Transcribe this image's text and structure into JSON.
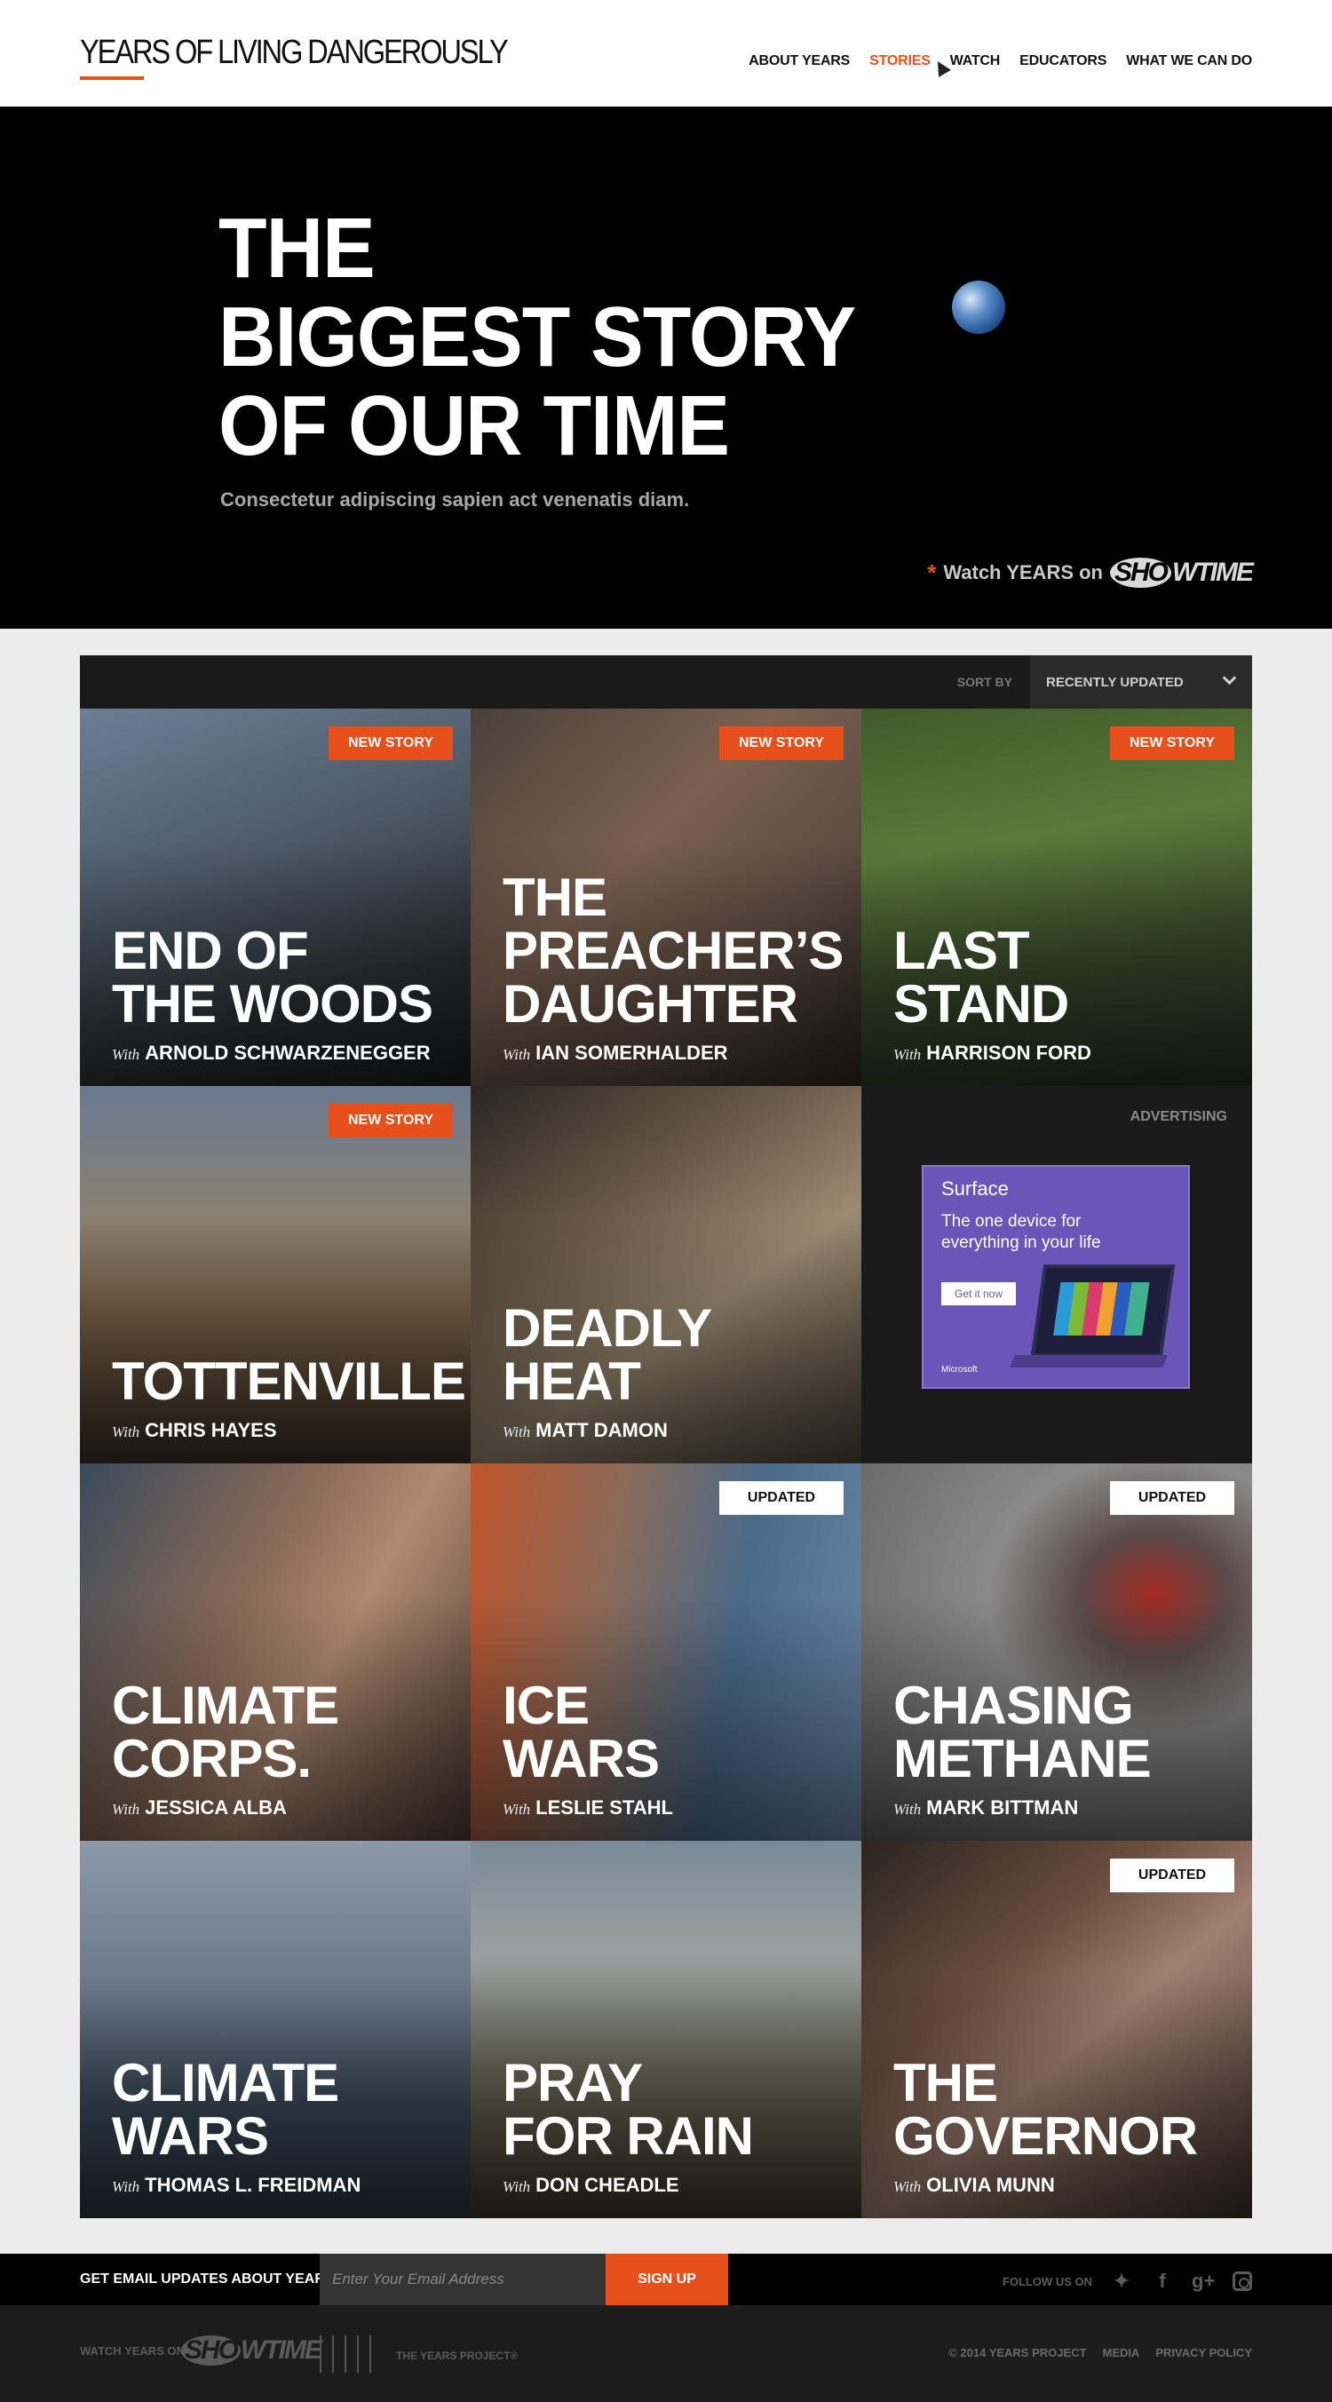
{
  "header": {
    "logo": "YEARS OF LIVING DANGEROUSLY",
    "nav": [
      "ABOUT YEARS",
      "STORIES",
      "WATCH",
      "EDUCATORS",
      "WHAT WE CAN DO"
    ],
    "active_nav": "STORIES"
  },
  "hero": {
    "title_lines": [
      "THE",
      "BIGGEST STORY",
      "OF OUR TIME"
    ],
    "subtitle": "Consectetur adipiscing sapien act venenatis diam.",
    "watch_star": "*",
    "watch_text": "Watch YEARS on",
    "showtime_sho": "SHO",
    "showtime_rest": "WTIME"
  },
  "sort": {
    "label": "SORT BY",
    "selected": "RECENTLY UPDATED"
  },
  "with_label": "With",
  "stories": [
    {
      "title": [
        "END OF",
        "THE WOODS"
      ],
      "host": "ARNOLD SCHWARZENEGGER",
      "badge": "NEW STORY"
    },
    {
      "title": [
        "THE",
        "PREACHER’S",
        "DAUGHTER"
      ],
      "host": "IAN SOMERHALDER",
      "badge": "NEW STORY"
    },
    {
      "title": [
        "LAST",
        "STAND"
      ],
      "host": "HARRISON FORD",
      "badge": "NEW STORY"
    },
    {
      "title": [
        "TOTTENVILLE"
      ],
      "host": "CHRIS HAYES",
      "badge": "NEW STORY"
    },
    {
      "title": [
        "DEADLY",
        "HEAT"
      ],
      "host": "MATT DAMON",
      "badge": ""
    },
    {
      "title": [
        "CLIMATE",
        "CORPS."
      ],
      "host": "JESSICA ALBA",
      "badge": ""
    },
    {
      "title": [
        "ICE",
        "WARS"
      ],
      "host": "LESLIE STAHL",
      "badge": "UPDATED"
    },
    {
      "title": [
        "CHASING",
        "METHANE"
      ],
      "host": "MARK BITTMAN",
      "badge": "UPDATED"
    },
    {
      "title": [
        "CLIMATE",
        "WARS"
      ],
      "host": "THOMAS L. FREIDMAN",
      "badge": ""
    },
    {
      "title": [
        "PRAY",
        "FOR RAIN"
      ],
      "host": "DON CHEADLE",
      "badge": ""
    },
    {
      "title": [
        "THE",
        "GOVERNOR"
      ],
      "host": "OLIVIA MUNN",
      "badge": "UPDATED"
    }
  ],
  "ad": {
    "label": "ADVERTISING",
    "brand": "Surface",
    "text": "The one device for everything in your life",
    "button": "Get it now",
    "maker": "Microsoft"
  },
  "newsletter": {
    "label": "GET EMAIL UPDATES ABOUT YEARS",
    "placeholder": "Enter Your Email Address",
    "button": "SIGN UP",
    "follow": "FOLLOW US ON",
    "social": [
      "twitter-icon",
      "facebook-icon",
      "google-plus-icon",
      "instagram-icon"
    ]
  },
  "footer": {
    "watch": "WATCH YEARS ON",
    "showtime_sho": "SHO",
    "showtime_rest": "WTIME",
    "years_project": "THE YEARS PROJECT®",
    "links": [
      "© 2014 YEARS PROJECT",
      "MEDIA",
      "PRIVACY POLICY"
    ]
  },
  "colors": {
    "accent": "#e8501b",
    "hero_bg": "#000000",
    "page_bg": "#ececec"
  }
}
